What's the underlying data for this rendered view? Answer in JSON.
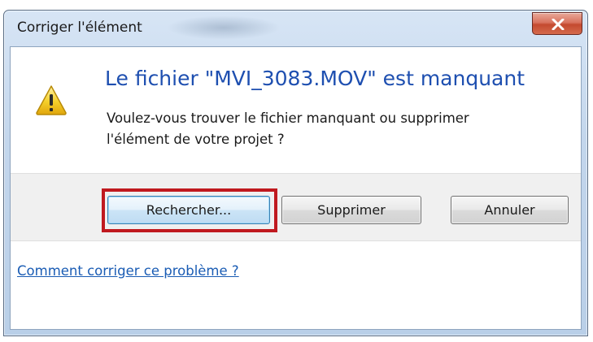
{
  "window": {
    "title": "Corriger l'élément"
  },
  "title_bar": {
    "close_icon": "close-x-icon"
  },
  "dialog": {
    "icon": "warning-icon",
    "main_instruction": "Le fichier \"MVI_3083.MOV\" est manquant",
    "message_line1": "Voulez-vous trouver le fichier manquant ou supprimer",
    "message_line2": "l'élément de votre projet ?"
  },
  "buttons": {
    "search_label": "Rechercher...",
    "delete_label": "Supprimer",
    "cancel_label": "Annuler"
  },
  "annotation": {
    "highlight_color": "#c0191f"
  },
  "footer": {
    "help_link": "Comment corriger ce problème ?"
  },
  "colors": {
    "instruction_blue": "#1e4fb0",
    "link_blue": "#1a5cb4",
    "close_red": "#c44a30"
  }
}
